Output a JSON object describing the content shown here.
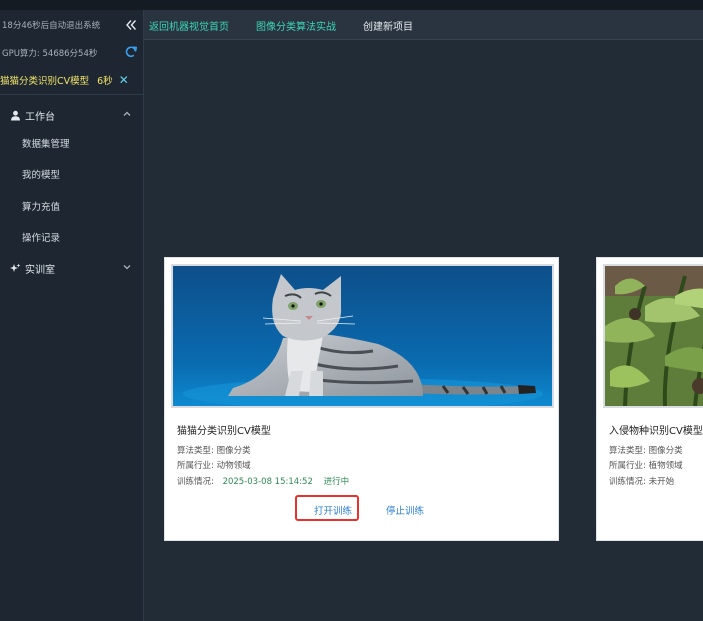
{
  "header": {
    "auto_logout_notice": "18分46秒后自动退出系统",
    "gpu_compute": "GPU算力: 54686分54秒"
  },
  "active_task": {
    "name": "猫猫分类识别CV模型",
    "time": "6秒",
    "close_icon": "close-icon"
  },
  "sidebar": {
    "workbench": {
      "label": "工作台",
      "icon": "user-icon"
    },
    "items": [
      {
        "label": "数据集管理"
      },
      {
        "label": "我的模型"
      },
      {
        "label": "算力充值"
      },
      {
        "label": "操作记录"
      }
    ],
    "lab": {
      "label": "实训室",
      "icon": "sparkle-icon"
    }
  },
  "topnav": {
    "collapse_icon": "double-chevron-left-icon",
    "back_home": "返回机器视觉首页",
    "algorithm_practice": "图像分类算法实战",
    "create_project": "创建新项目"
  },
  "cards": [
    {
      "title": "猫猫分类识别CV模型",
      "algorithm_label": "算法类型:",
      "algorithm": "图像分类",
      "industry_label": "所属行业:",
      "industry": "动物领域",
      "training_label": "训练情况:",
      "training_date": "2025-03-08 15:14:52",
      "training_status": "进行中",
      "open_training": "打开训练",
      "stop_training": "停止训练"
    },
    {
      "title": "入侵物种识别CV模型",
      "algorithm_label": "算法类型:",
      "algorithm": "图像分类",
      "industry_label": "所属行业:",
      "industry": "植物领域",
      "training_label": "训练情况:",
      "training_status": "未开始"
    }
  ],
  "colors": {
    "accent": "#3cd6b9",
    "task_highlight": "#f2e36a",
    "link_blue": "#2a7fd4",
    "status_green": "#2e8b57",
    "highlight_red": "#e8322f"
  }
}
